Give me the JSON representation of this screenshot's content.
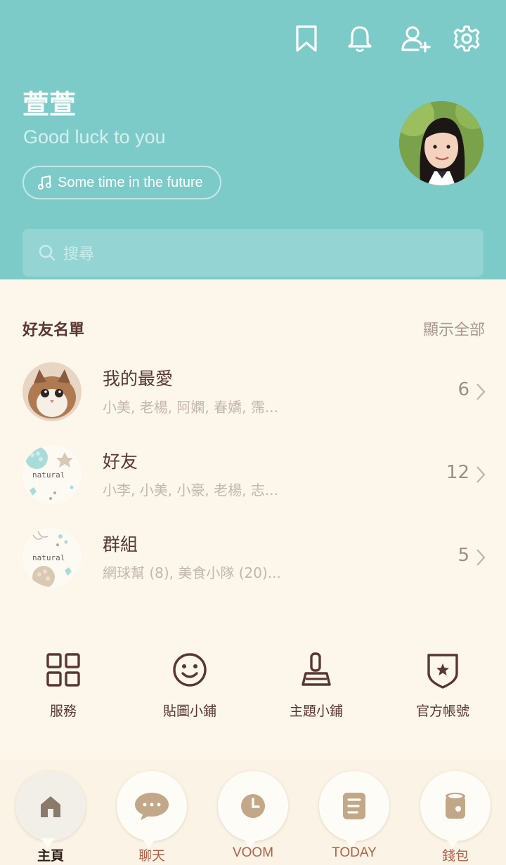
{
  "header": {
    "icons": [
      "bookmark-icon",
      "bell-icon",
      "add-friend-icon",
      "gear-icon"
    ],
    "profile_name": "萱萱",
    "status_message": "Good luck to you",
    "music": "Some time in the future",
    "search_placeholder": "搜尋"
  },
  "friends": {
    "title": "好友名單",
    "show_all": "顯示全部",
    "rows": [
      {
        "title": "我的最愛",
        "subtitle": "小美, 老楊, 阿嫻, 春嬌, 霈...",
        "count": "6"
      },
      {
        "title": "好友",
        "subtitle": "小李, 小美, 小豪, 老楊, 志...",
        "count": "12"
      },
      {
        "title": "群組",
        "subtitle": "網球幫 (8), 美食小隊 (20)...",
        "count": "5"
      }
    ],
    "thumb_text": "natural"
  },
  "quick_menu": [
    {
      "label": "服務",
      "icon": "grid-icon"
    },
    {
      "label": "貼圖小鋪",
      "icon": "smiley-icon"
    },
    {
      "label": "主題小鋪",
      "icon": "brush-icon"
    },
    {
      "label": "官方帳號",
      "icon": "shield-star-icon"
    }
  ],
  "bottom_nav": [
    {
      "label": "主頁",
      "icon": "home-icon",
      "active": true
    },
    {
      "label": "聊天",
      "icon": "chat-icon",
      "active": false
    },
    {
      "label": "VOOM",
      "icon": "clock-icon",
      "active": false
    },
    {
      "label": "TODAY",
      "icon": "news-icon",
      "active": false
    },
    {
      "label": "錢包",
      "icon": "wallet-icon",
      "active": false
    }
  ],
  "colors": {
    "header_bg": "#7ccbc9",
    "body_bg": "#fdf6ea",
    "text_dark": "#5a3632",
    "text_muted": "#c4b7ad",
    "nav_label": "#b0604a"
  }
}
